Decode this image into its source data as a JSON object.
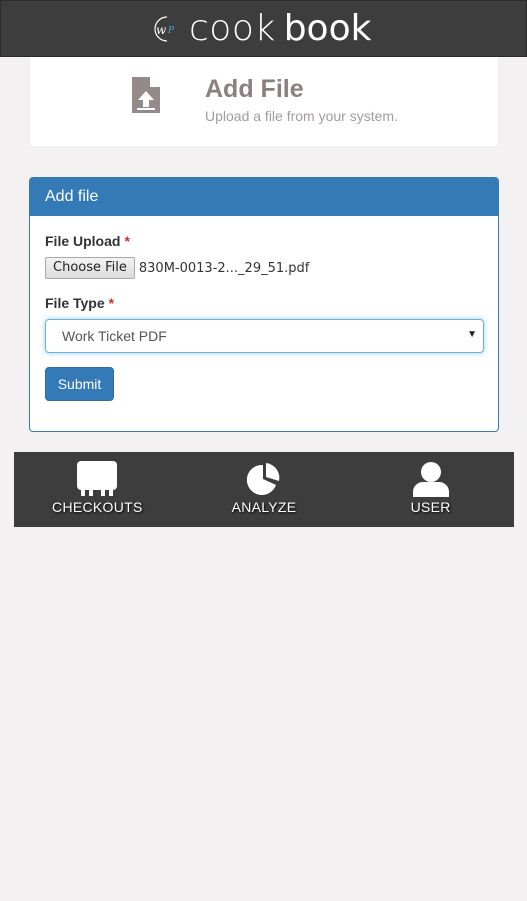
{
  "brand": {
    "cook": "cook",
    "book": "book",
    "logo_icon": "wp-logo-icon"
  },
  "header": {
    "title": "Add File",
    "subtitle": "Upload a file from your system.",
    "icon": "file-upload-icon"
  },
  "panel": {
    "heading": "Add file",
    "file_upload_label": "File Upload",
    "required_mark": "*",
    "choose_file_label": "Choose File",
    "file_name": "830M-0013-2..._29_51.pdf",
    "file_type_label": "File Type",
    "file_type_value": "Work Ticket PDF",
    "submit_label": "Submit"
  },
  "nav": {
    "items": [
      {
        "label": "CHECKOUTS",
        "icon": "checkouts-icon"
      },
      {
        "label": "ANALYZE",
        "icon": "pie-chart-icon"
      },
      {
        "label": "USER",
        "icon": "user-icon"
      }
    ]
  },
  "colors": {
    "primary": "#337ab7",
    "topbar": "#3d3d3d",
    "background": "#f3f1f1",
    "required": "#c9302c"
  }
}
